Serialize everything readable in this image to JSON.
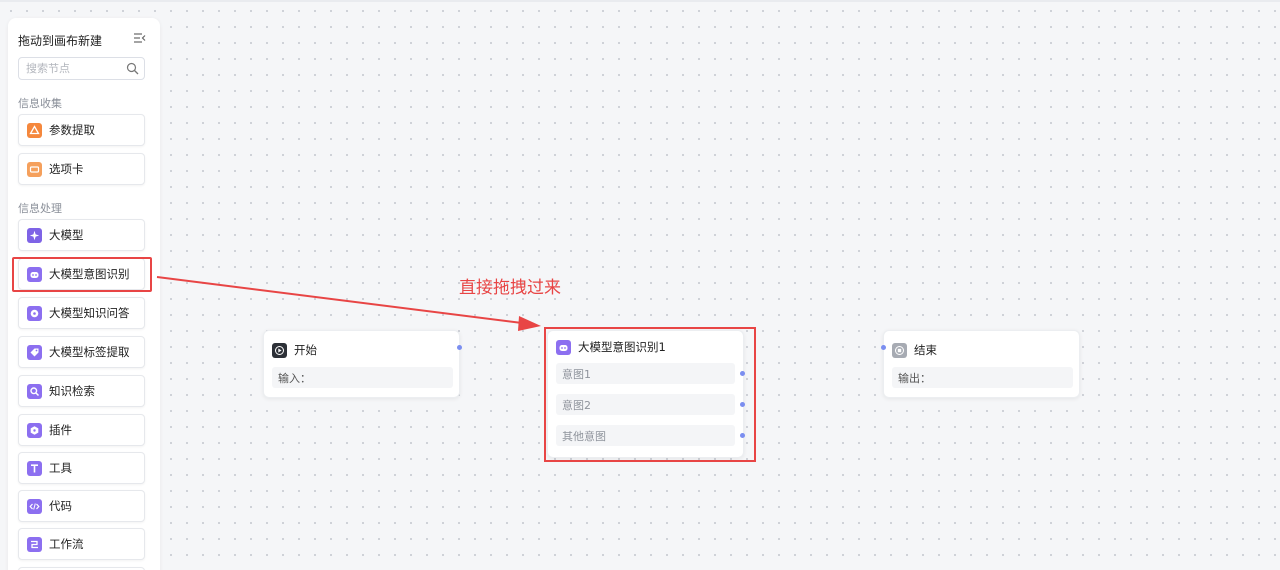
{
  "sidebar": {
    "title": "拖动到画布新建",
    "collapse_icon": "collapse-icon",
    "search": {
      "placeholder": "搜索节点",
      "icon": "search-icon"
    },
    "sections": [
      {
        "label": "信息收集",
        "items": [
          {
            "label": "参数提取",
            "icon": "param-extract-icon",
            "color": "#f5883d"
          },
          {
            "label": "选项卡",
            "icon": "options-card-icon",
            "color": "#f5a05c"
          }
        ]
      },
      {
        "label": "信息处理",
        "items": [
          {
            "label": "大模型",
            "icon": "llm-sparkle-icon",
            "color": "#7e63e6"
          },
          {
            "label": "大模型意图识别",
            "icon": "intent-robot-icon",
            "color": "#8c6ff0"
          },
          {
            "label": "大模型知识问答",
            "icon": "knowledge-qa-icon",
            "color": "#8c6ff0"
          },
          {
            "label": "大模型标签提取",
            "icon": "tag-icon",
            "color": "#8c6ff0"
          },
          {
            "label": "知识检索",
            "icon": "search-doc-icon",
            "color": "#8c6ff0"
          },
          {
            "label": "插件",
            "icon": "plugin-icon",
            "color": "#8c6ff0"
          },
          {
            "label": "工具",
            "icon": "tool-icon",
            "color": "#8c6ff0"
          },
          {
            "label": "代码",
            "icon": "code-icon",
            "color": "#8c6ff0"
          },
          {
            "label": "工作流",
            "icon": "workflow-icon",
            "color": "#8c6ff0"
          }
        ]
      }
    ]
  },
  "annotation": {
    "text": "直接拖拽过来",
    "color": "#e84545"
  },
  "canvas": {
    "start_node": {
      "title": "开始",
      "field": "输入：",
      "icon": "play-icon"
    },
    "intent_node": {
      "title": "大模型意图识别1",
      "icon": "intent-robot-icon",
      "intents": [
        "意图1",
        "意图2",
        "其他意图"
      ]
    },
    "end_node": {
      "title": "结束",
      "field": "输出：",
      "icon": "stop-icon"
    }
  },
  "colors": {
    "accent_red": "#e84545",
    "port": "#7b8ef0",
    "purple": "#8c6ff0"
  }
}
